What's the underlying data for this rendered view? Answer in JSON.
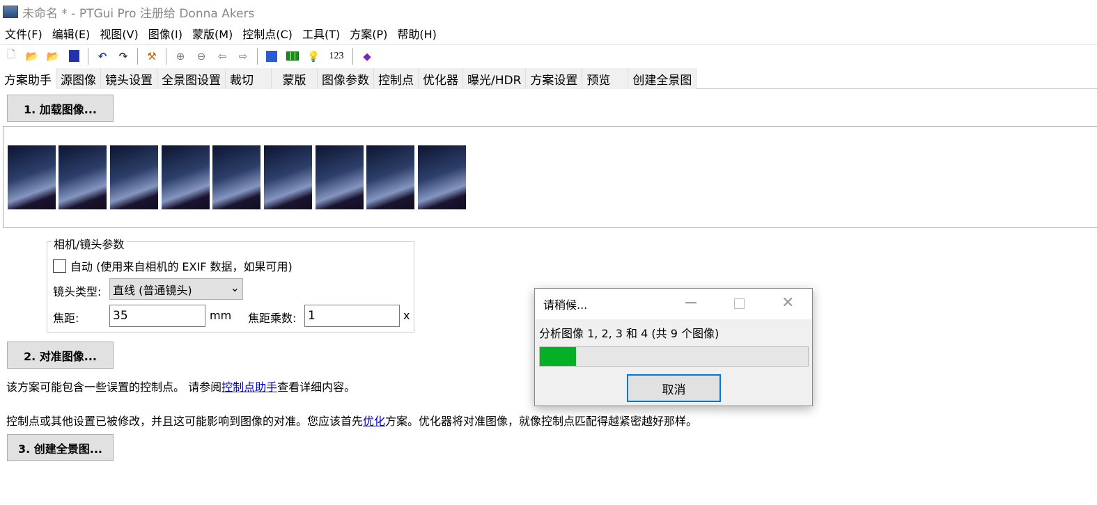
{
  "title": "未命名 * - PTGui Pro 注册给 Donna Akers",
  "menu": [
    "文件(F)",
    "编辑(E)",
    "视图(V)",
    "图像(I)",
    "蒙版(M)",
    "控制点(C)",
    "工具(T)",
    "方案(P)",
    "帮助(H)"
  ],
  "toolbar": {
    "numbers_label": "123"
  },
  "tabs": [
    "方案助手",
    "源图像",
    "镜头设置",
    "全景图设置",
    "裁切",
    "蒙版",
    "图像参数",
    "控制点",
    "优化器",
    "曝光/HDR",
    "方案设置",
    "预览",
    "创建全景图"
  ],
  "step1": "1. 加载图像...",
  "step2": "2. 对准图像...",
  "step3": "3. 创建全景图...",
  "thumbnail_count": 9,
  "camera": {
    "legend": "相机/镜头参数",
    "auto_label": "自动 (使用来自相机的 EXIF 数据，如果可用)",
    "auto_checked": false,
    "lens_type_label": "镜头类型:",
    "lens_type_value": "直线 (普通镜头)",
    "focal_label": "焦距:",
    "focal_value": "35",
    "focal_unit": "mm",
    "multiplier_label": "焦距乘数:",
    "multiplier_value": "1",
    "multiplier_unit": "x"
  },
  "msg1": {
    "before": "该方案可能包含一些误置的控制点。 请参阅",
    "link": "控制点助手",
    "after": "查看详细内容。"
  },
  "msg2": {
    "before": "控制点或其他设置已被修改，并且这可能影响到图像的对准。您应该首先",
    "link": "优化",
    "after": "方案。优化器将对准图像，就像控制点匹配得越紧密越好那样。"
  },
  "dialog": {
    "title": "请稍候...",
    "message": "分析图像 1, 2, 3 和 4 (共 9 个图像)",
    "progress": 0.135,
    "cancel": "取消",
    "progress_color": "#06b025"
  }
}
